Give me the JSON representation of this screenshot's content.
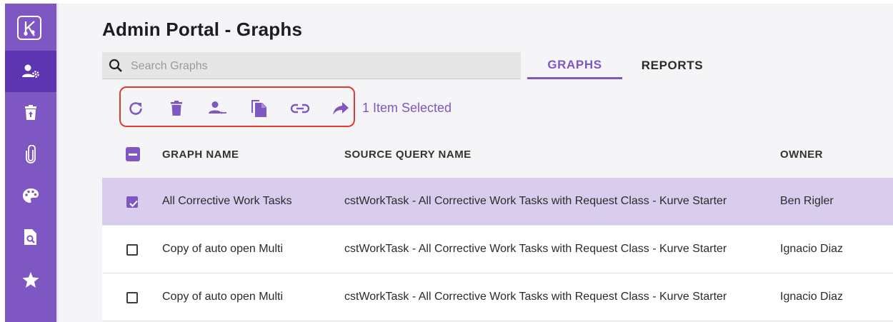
{
  "page": {
    "title": "Admin Portal - Graphs"
  },
  "sidebar": {
    "items": [
      {
        "icon": "admin-settings-icon",
        "active": true
      },
      {
        "icon": "trash-icon",
        "active": false
      },
      {
        "icon": "paperclip-icon",
        "active": false
      },
      {
        "icon": "palette-icon",
        "active": false
      },
      {
        "icon": "document-search-icon",
        "active": false
      },
      {
        "icon": "star-icon",
        "active": false
      }
    ]
  },
  "search": {
    "placeholder": "Search Graphs",
    "value": ""
  },
  "tabs": {
    "graphs": "GRAPHS",
    "reports": "REPORTS",
    "active": "GRAPHS"
  },
  "toolbar": {
    "icons": [
      "refresh-icon",
      "delete-icon",
      "transfer-owner-icon",
      "copy-icon",
      "link-icon",
      "share-icon"
    ],
    "selection_text": "1 Item Selected"
  },
  "table": {
    "columns": {
      "name": "GRAPH NAME",
      "query": "SOURCE QUERY NAME",
      "owner": "OWNER"
    },
    "rows": [
      {
        "name": "All Corrective Work Tasks",
        "query": "cstWorkTask - All Corrective Work Tasks with Request Class - Kurve Starter",
        "owner": "Ben Rigler",
        "checked": true
      },
      {
        "name": "Copy of auto open Multi",
        "query": "cstWorkTask - All Corrective Work Tasks with Request Class - Kurve Starter",
        "owner": "Ignacio Diaz",
        "checked": false
      },
      {
        "name": "Copy of auto open Multi",
        "query": "cstWorkTask - All Corrective Work Tasks with Request Class - Kurve Starter",
        "owner": "Ignacio Diaz",
        "checked": false
      }
    ]
  },
  "colors": {
    "accent": "#7e57c2",
    "accent_dark": "#5e35b1",
    "selected_row": "#d9cdee",
    "highlight": "#e53935"
  }
}
